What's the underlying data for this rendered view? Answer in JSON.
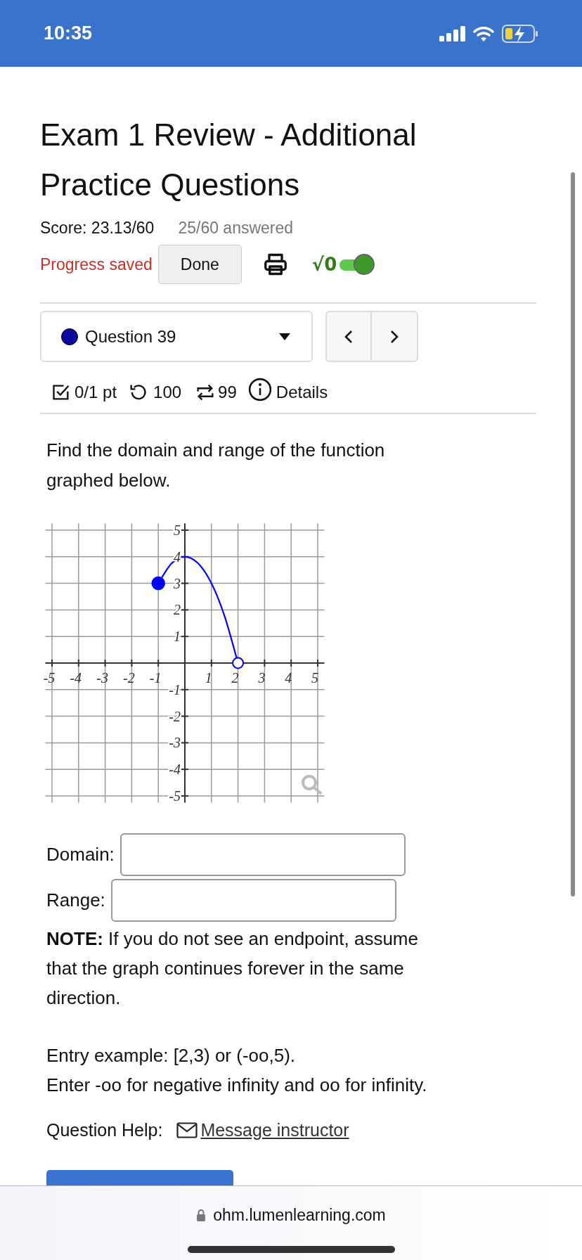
{
  "status_bar": {
    "time": "10:35"
  },
  "title": "Exam 1 Review - Additional Practice Questions",
  "score": "Score: 23.13/60",
  "answered": "25/60 answered",
  "save_status": "Progress saved",
  "done_button": "Done",
  "math_toggle": {
    "label": "√0",
    "on": true
  },
  "question_select": {
    "label": "Question 39"
  },
  "question_meta": {
    "points": "0/1 pt",
    "attempts": "100",
    "regens": "99",
    "details": "Details"
  },
  "question_text": "Find the domain and range of the function graphed below.",
  "graph": {
    "chart_data": {
      "type": "line",
      "x": [
        -1,
        -0.5,
        0,
        0.5,
        1,
        1.5,
        2
      ],
      "series": [
        {
          "color": "#0000ff",
          "values": [
            3,
            3.75,
            4,
            3.75,
            3,
            1.75,
            0
          ]
        }
      ],
      "xlim": [
        -5,
        5
      ],
      "ylim": [
        -5,
        5
      ],
      "xticks": [
        -5,
        -4,
        -3,
        -2,
        -1,
        1,
        2,
        3,
        4,
        5
      ],
      "yticks": [
        -5,
        -4,
        -3,
        -2,
        -1,
        1,
        2,
        3,
        4,
        5
      ],
      "grid": true
    },
    "endpoints": [
      {
        "filled": true
      },
      {
        "filled": false
      }
    ]
  },
  "answers": [
    {
      "label": "Domain:"
    },
    {
      "label": "Range:"
    }
  ],
  "note": "**NOTE:** If you do not see an endpoint, assume that the graph continues forever in the same direction.",
  "entry_example": "Entry example: [2,3) or (-oo,5).",
  "entry_hint": "Enter -oo for negative infinity and oo for infinity.",
  "help": {
    "label": "Question Help:",
    "link": "Message instructor"
  },
  "url": "ohm.lumenlearning.com"
}
